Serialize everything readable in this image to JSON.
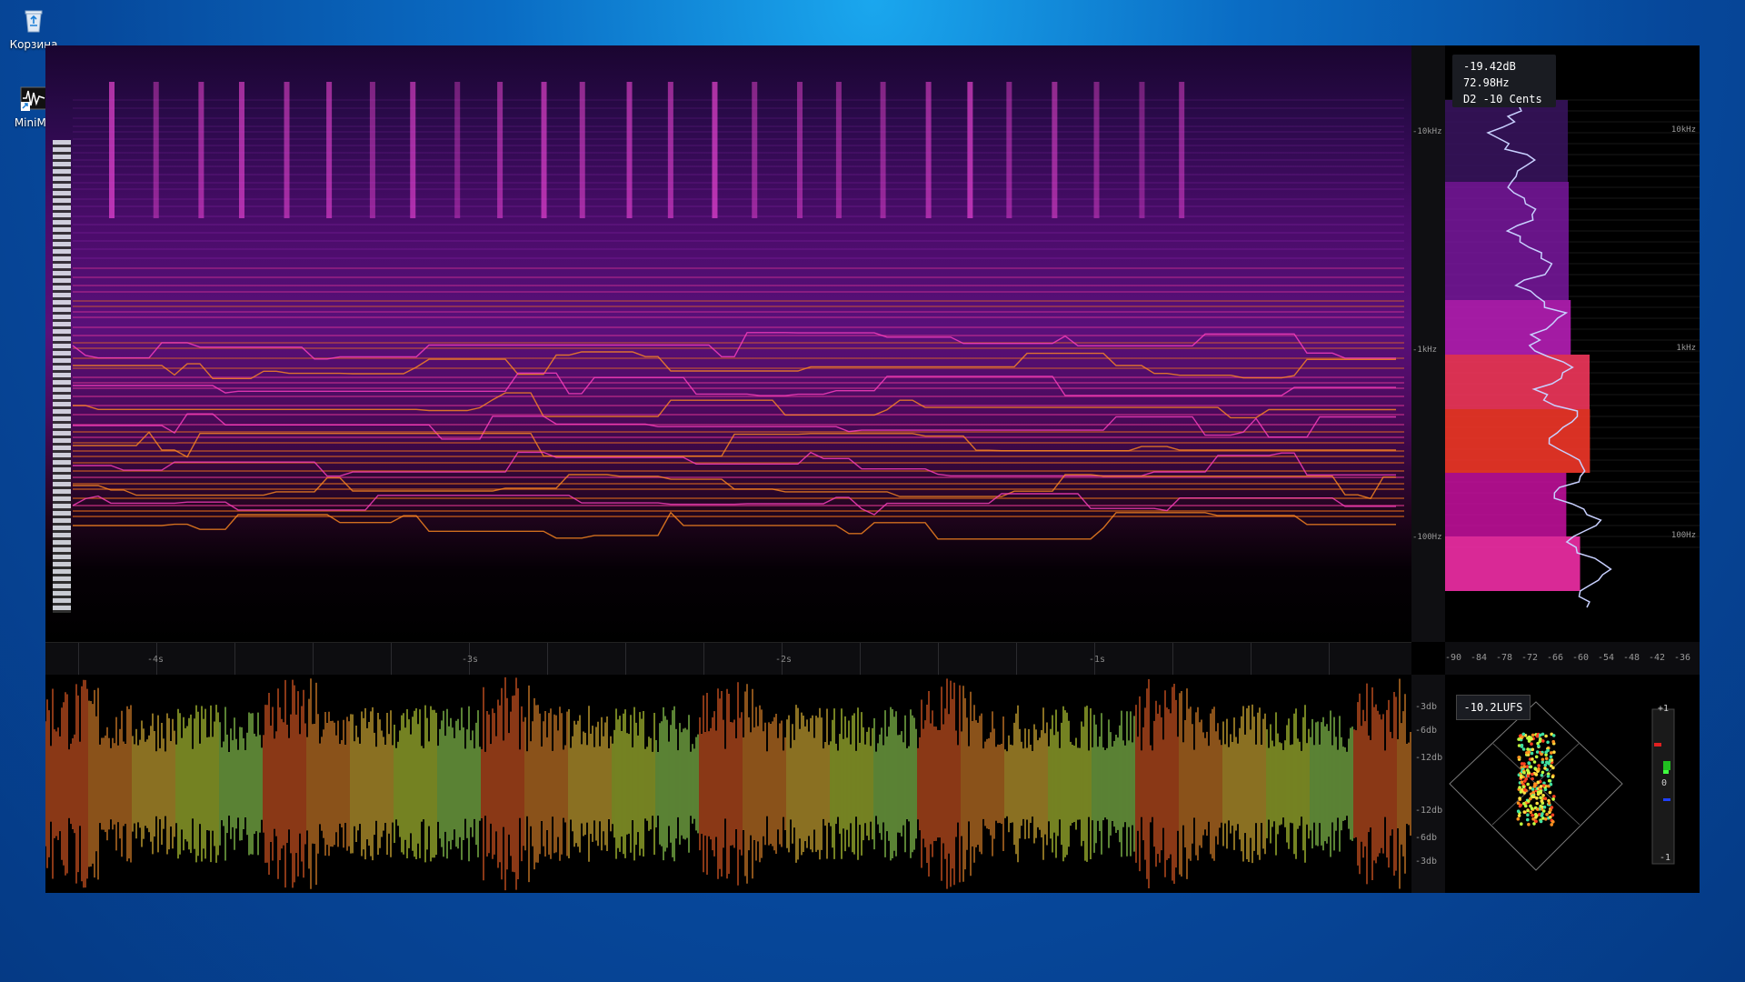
{
  "desktop": {
    "icons": [
      {
        "label": "Корзина",
        "icon": "recycle-bin-icon"
      },
      {
        "label": "MiniMe",
        "icon": "waveform-app-icon"
      }
    ]
  },
  "spectrogram": {
    "time_ticks": [
      "-4s",
      "-3s",
      "-2s",
      "-1s"
    ],
    "freq_labels_left": [
      "-10kHz",
      "-1kHz",
      "-100Hz"
    ]
  },
  "readout": {
    "level": "-19.42dB",
    "frequency": "72.98Hz",
    "note": "D2  -10 Cents"
  },
  "spectrum": {
    "freq_labels_right": [
      "10kHz",
      "1kHz",
      "100Hz"
    ],
    "db_ticks": [
      "-90",
      "-84",
      "-78",
      "-72",
      "-66",
      "-60",
      "-54",
      "-48",
      "-42",
      "-36"
    ]
  },
  "waveform": {
    "scale_labels": [
      "-3db",
      "-6db",
      "-12db",
      "-12db",
      "-6db",
      "-3db"
    ]
  },
  "vectorscope": {
    "lufs": "-10.2LUFS",
    "correlation_labels": [
      "+1",
      "0",
      "-1"
    ]
  },
  "colors": {
    "desktop_blue": "#0a6cc4",
    "spectro_hot": "#ff6a1a",
    "spectro_mid": "#c838e0",
    "spectrum_line": "#c8d0ff"
  }
}
